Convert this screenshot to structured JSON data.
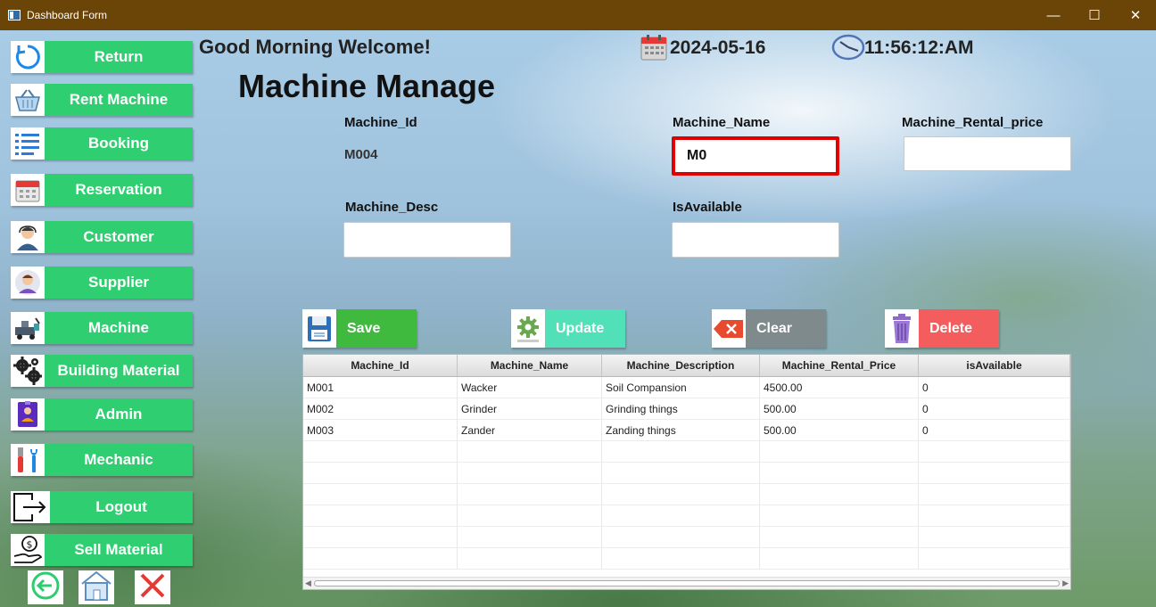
{
  "window": {
    "title": "Dashboard Form",
    "minimize": "—",
    "maximize": "☐",
    "close": "✕"
  },
  "sidebar": [
    {
      "label": "Return",
      "icon": "refresh-icon"
    },
    {
      "label": "Rent Machine",
      "icon": "basket-icon"
    },
    {
      "label": "Booking",
      "icon": "list-icon"
    },
    {
      "label": "Reservation",
      "icon": "calendar-icon"
    },
    {
      "label": "Customer",
      "icon": "customer-icon"
    },
    {
      "label": "Supplier",
      "icon": "supplier-icon"
    },
    {
      "label": "Machine",
      "icon": "machine-icon"
    },
    {
      "label": "Building Material",
      "icon": "gears-icon"
    },
    {
      "label": "Admin",
      "icon": "admin-icon"
    },
    {
      "label": "Mechanic",
      "icon": "tools-icon"
    },
    {
      "label": "Logout",
      "icon": "logout-icon"
    },
    {
      "label": "Sell Material",
      "icon": "money-hand-icon"
    }
  ],
  "header": {
    "greeting": "Good Morning Welcome!",
    "date": "2024-05-16",
    "time": "11:56:12:AM",
    "page_title": "Machine Manage"
  },
  "form": {
    "machine_id_label": "Machine_Id",
    "machine_id_value": "M004",
    "machine_name_label": "Machine_Name",
    "machine_name_value": "M0",
    "rental_price_label": "Machine_Rental_price",
    "rental_price_value": "",
    "desc_label": "Machine_Desc",
    "desc_value": "",
    "available_label": "IsAvailable",
    "available_value": ""
  },
  "actions": {
    "save": "Save",
    "update": "Update",
    "clear": "Clear",
    "delete": "Delete"
  },
  "table": {
    "columns": [
      "Machine_Id",
      "Machine_Name",
      "Machine_Description",
      "Machine_Rental_Price",
      "isAvailable"
    ],
    "rows": [
      [
        "M001",
        "Wacker",
        "Soil Compansion",
        "4500.00",
        "0"
      ],
      [
        "M002",
        "Grinder",
        "Grinding things",
        "500.00",
        "0"
      ],
      [
        "M003",
        "Zander",
        "Zanding things",
        "500.00",
        "0"
      ]
    ]
  },
  "colors": {
    "sidebar_green": "#2fce71",
    "titlebar": "#6b4408",
    "save": "#3fba3f",
    "update": "#52e0b8",
    "clear": "#7f8a8c",
    "delete": "#f45d5d"
  }
}
